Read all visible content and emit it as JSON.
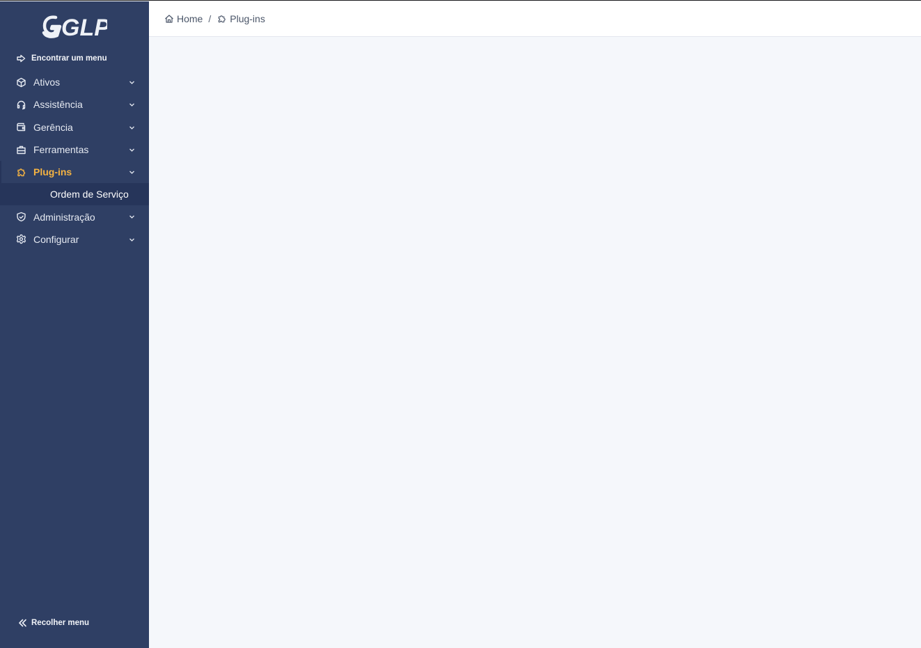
{
  "sidebar": {
    "logo_text": "GLPI",
    "find_menu_label": "Encontrar um menu",
    "items": [
      {
        "label": "Ativos",
        "icon": "box-icon"
      },
      {
        "label": "Assistência",
        "icon": "headset-icon"
      },
      {
        "label": "Gerência",
        "icon": "wallet-icon"
      },
      {
        "label": "Ferramentas",
        "icon": "briefcase-icon"
      },
      {
        "label": "Plug-ins",
        "icon": "puzzle-icon",
        "active": true
      },
      {
        "label": "Administração",
        "icon": "shield-icon"
      },
      {
        "label": "Configurar",
        "icon": "gear-icon"
      }
    ],
    "submenu": {
      "label": "Ordem de Serviço"
    },
    "collapse_label": "Recolher menu"
  },
  "breadcrumb": {
    "home": "Home",
    "separator": "/",
    "current": "Plug-ins"
  },
  "colors": {
    "sidebar_bg": "#2f3f64",
    "active_accent": "#f5b342",
    "submenu_bg": "#26355a",
    "content_bg": "#f5f7fb"
  }
}
